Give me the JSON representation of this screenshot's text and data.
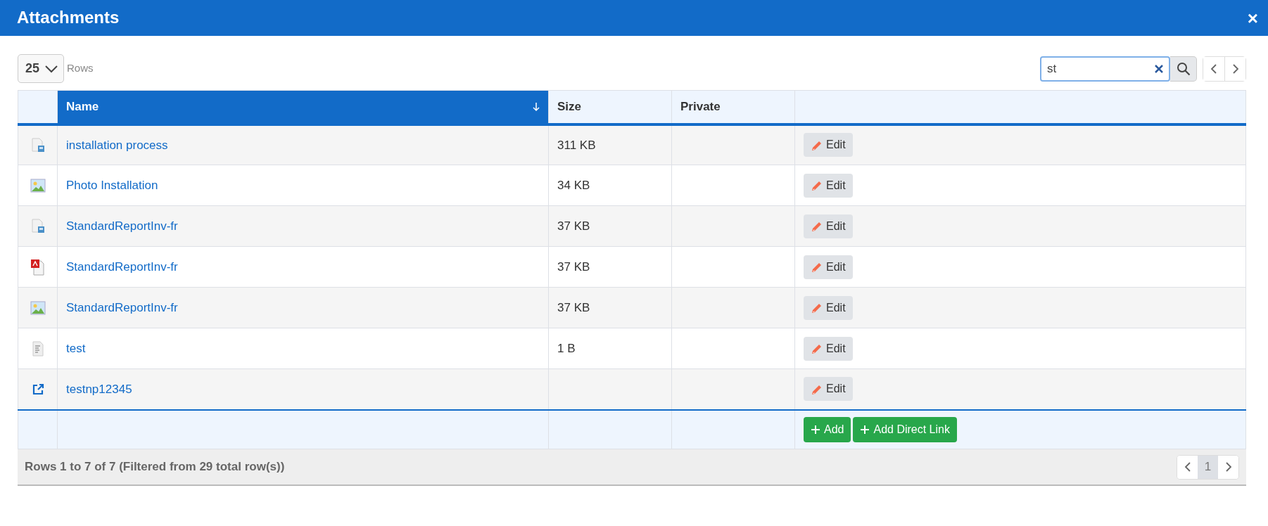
{
  "window": {
    "title": "Attachments",
    "close": "×"
  },
  "toolbar": {
    "page_size": "25",
    "page_size_label": "Rows",
    "search": {
      "value": "st"
    }
  },
  "table": {
    "columns": [
      {
        "label": "Name",
        "sorted": true
      },
      {
        "label": "Size",
        "sorted": false
      },
      {
        "label": "Private",
        "sorted": false
      }
    ],
    "rows": [
      {
        "kind": "document",
        "name": "installation process",
        "size": "311 KB",
        "action": "Edit"
      },
      {
        "kind": "image",
        "name": "Photo Installation",
        "size": "34 KB",
        "action": "Edit"
      },
      {
        "kind": "document",
        "name": "StandardReportInv-fr",
        "size": "37 KB",
        "action": "Edit"
      },
      {
        "kind": "pdf",
        "name": "StandardReportInv-fr",
        "size": "37 KB",
        "action": "Edit"
      },
      {
        "kind": "image",
        "name": "StandardReportInv-fr",
        "size": "37 KB",
        "action": "Edit"
      },
      {
        "kind": "text",
        "name": "test",
        "size": "1 B",
        "action": "Edit"
      },
      {
        "kind": "link",
        "name": "testnp12345",
        "size": "",
        "action": "Edit"
      }
    ],
    "footer_buttons": [
      "Add",
      "Add Direct Link"
    ]
  },
  "status_bar": {
    "summary": "Rows 1 to 7 of 7 (Filtered from 29 total row(s))",
    "pages": [
      {
        "label": "1",
        "selected": true
      }
    ]
  }
}
